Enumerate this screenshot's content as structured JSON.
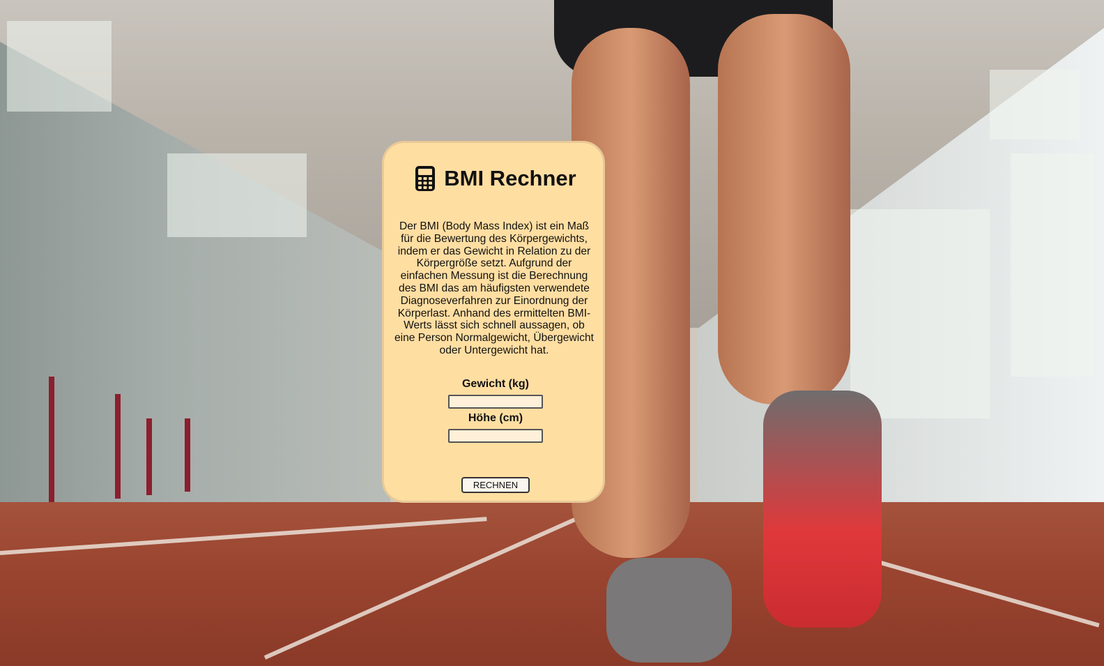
{
  "app": {
    "title": "BMI Rechner",
    "title_icon": "calculator-icon",
    "description": "Der BMI (Body Mass Index) ist ein Maß für die Bewertung des Körpergewichts, indem er das Gewicht in Relation zu der Körpergröße setzt. Aufgrund der einfachen Messung ist die Berechnung des BMI das am häufigsten verwendete Diagnoseverfahren zur Einordnung der Körperlast. Anhand des ermittelten BMI-Werts lässt sich schnell aussagen, ob eine Person Normalgewicht, Übergewicht oder Untergewicht hat."
  },
  "form": {
    "weight_label": "Gewicht (kg)",
    "weight_value": "",
    "height_label": "Höhe (cm)",
    "height_value": "",
    "submit_label": "RECHNEN"
  },
  "colors": {
    "card_background": "#ffdea2",
    "card_border": "#e9c997",
    "input_background": "#fff0d9"
  },
  "background": {
    "image_subject": "runner-legs-on-indoor-track"
  }
}
